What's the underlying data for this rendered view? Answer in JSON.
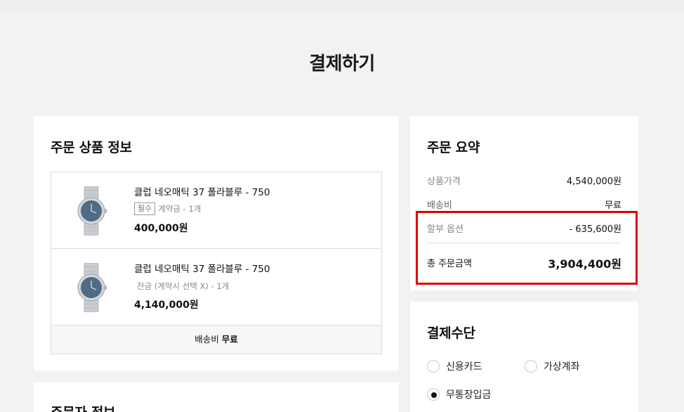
{
  "page": {
    "title": "결제하기"
  },
  "products": {
    "section_title": "주문 상품 정보",
    "items": [
      {
        "name": "클럽 네오매틱 37 폴라블루 - 750",
        "tag": "필수",
        "option": "계약금 - 1개",
        "price": "400,000원"
      },
      {
        "name": "클럽 네오매틱 37 폴라블루 - 750",
        "tag": "",
        "option": "잔금 (계약시 선택 X) - 1개",
        "price": "4,140,000원"
      }
    ],
    "shipping_label": "배송비",
    "shipping_value": "무료"
  },
  "orderer": {
    "section_title": "주문자 정보"
  },
  "summary": {
    "section_title": "주문 요약",
    "rows": [
      {
        "label": "상품가격",
        "value": "4,540,000원"
      },
      {
        "label": "배송비",
        "value": "무료"
      },
      {
        "label": "할부 옵션",
        "value": "- 635,600원"
      }
    ],
    "total_label": "총 주문금액",
    "total_value": "3,904,400원",
    "highlight_color": "#e00000"
  },
  "payment": {
    "section_title": "결제수단",
    "options": [
      {
        "label": "신용카드",
        "checked": false
      },
      {
        "label": "가상계좌",
        "checked": false
      },
      {
        "label": "무통장입금",
        "checked": true
      }
    ]
  }
}
